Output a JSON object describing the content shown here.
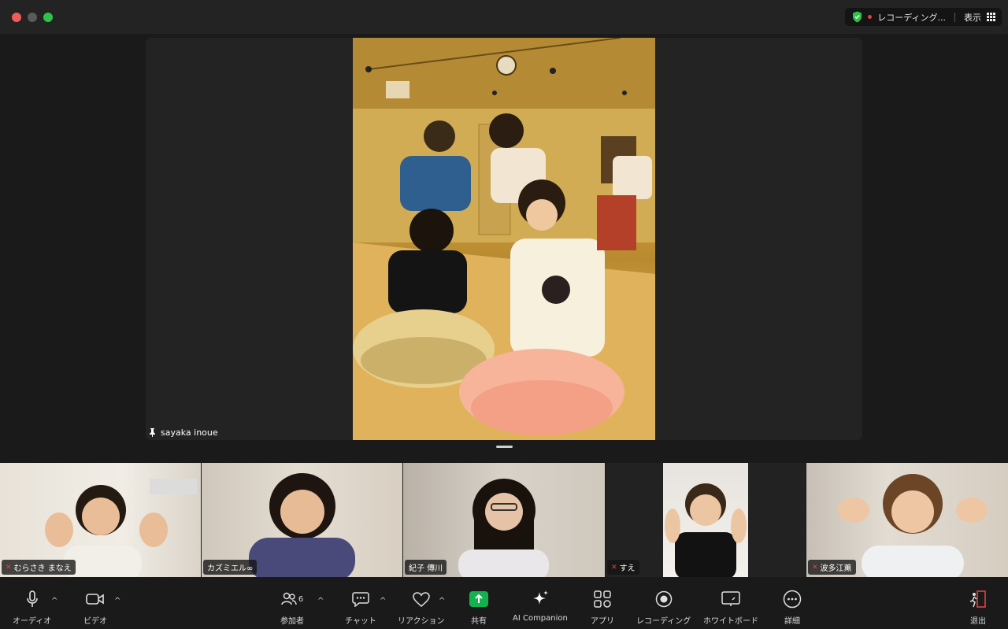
{
  "titlebar": {
    "recording_label": "レコーディング...",
    "view_label": "表示"
  },
  "stage": {
    "pinned_name": "sayaka inoue"
  },
  "gallery": [
    {
      "name": "むらさき まなえ",
      "muted": true
    },
    {
      "name": "カズミエル∞",
      "muted": false
    },
    {
      "name": "紀子 傳川",
      "muted": false
    },
    {
      "name": "すえ",
      "muted": true
    },
    {
      "name": "波多江薫",
      "muted": true
    }
  ],
  "toolbar": {
    "audio": "オーディオ",
    "video": "ビデオ",
    "participants": "参加者",
    "participants_count": "6",
    "chat": "チャット",
    "reactions": "リアクション",
    "share": "共有",
    "ai_companion": "AI Companion",
    "apps": "アプリ",
    "recording": "レコーディング",
    "whiteboard": "ホワイトボード",
    "more": "詳細",
    "leave": "退出"
  },
  "colors": {
    "share_green": "#12b24f",
    "leave_red": "#e0443c",
    "shield_green": "#2fc24a"
  }
}
